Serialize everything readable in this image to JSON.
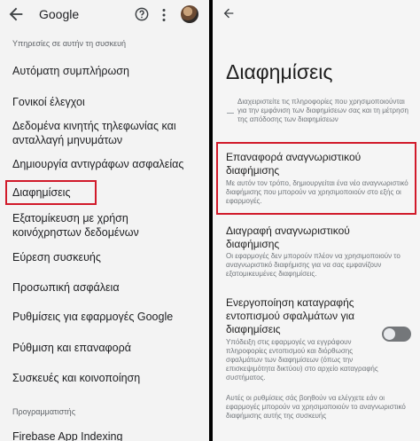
{
  "left": {
    "toolbar": {
      "title": "Google",
      "icons": [
        "back-arrow-icon",
        "help-icon",
        "more-vert-icon",
        "avatar"
      ]
    },
    "section_header": "Υπηρεσίες σε αυτήν τη συσκευή",
    "items": [
      "Αυτόματη συμπλήρωση",
      "Γονικοί έλεγχοι",
      "Δεδομένα κινητής τηλεφωνίας και ανταλλαγή μηνυμάτων",
      "Δημιουργία αντιγράφων ασφαλείας",
      "Διαφημίσεις",
      "Εξατομίκευση με χρήση κοινόχρηστων δεδομένων",
      "Εύρεση συσκευής",
      "Προσωπική ασφάλεια",
      "Ρυθμίσεις για εφαρμογές Google",
      "Ρύθμιση και επαναφορά",
      "Συσκευές και κοινοποίηση"
    ],
    "section_header_2": "Προγραμματιστής",
    "item_dev": "Firebase App Indexing",
    "highlight_color": "#d11a2a"
  },
  "right": {
    "title": "Διαφημίσεις",
    "intro": "Διαχειριστείτε τις πληροφορίες που χρησιμοποιούνται για την εμφάνιση των διαφημίσεων σας και τη μέτρηση της απόδοσης των διαφημίσεων",
    "items": [
      {
        "title": "Επαναφορά αναγνωριστικού διαφήμισης",
        "desc": "Με αυτόν τον τρόπο, δημιουργείται ένα νέο αναγνωριστικό διαφήμισης που μπορούν να χρησιμοποιούν στο εξής οι εφαρμογές."
      },
      {
        "title": "Διαγραφή αναγνωριστικού διαφήμισης",
        "desc": "Οι εφαρμογές δεν μπορούν πλέον να χρησιμοποιούν το αναγνωριστικό διαφήμισης για να σας εμφανίζουν εξατομικευμένες διαφημίσεις."
      },
      {
        "title": "Ενεργοποίηση καταγραφής εντοπισμού σφαλμάτων για διαφημίσεις",
        "desc": "Υπόδειξη στις εφαρμογές να εγγράφουν πληροφορίες εντοπισμού και διόρθωσης σφαλμάτων των διαφημίσεων (όπως την επισκεψιμότητα δικτύου) στο αρχείο καταγραφής συστήματος.",
        "toggle_on": false
      }
    ],
    "footer": "Αυτές οι ρυθμίσεις σάς βοηθούν να ελέγχετε εάν οι εφαρμογές μπορούν να χρησιμοποιούν το αναγνωριστικό διαφήμισης αυτής της συσκευής"
  }
}
